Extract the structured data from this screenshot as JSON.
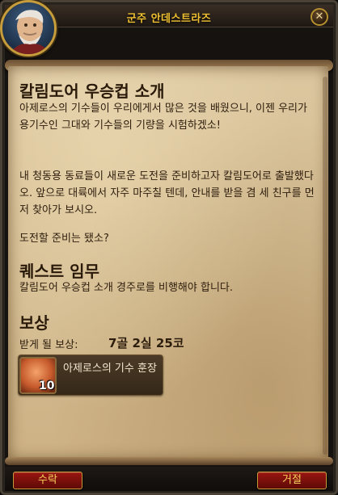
{
  "window": {
    "title": "군주 안데스트라즈",
    "close_icon": "close-icon",
    "portrait_icon": "npc-portrait-icon"
  },
  "quest": {
    "title": "칼림도어 우승컵 소개",
    "description_1": "아제로스의 기수들이 우리에게서 많은 것을 배웠으니, 이젠 우리가 용기수인 그대와 기수들의 기량을 시험하겠소!",
    "description_2": "내 청동용 동료들이 새로운 도전을 준비하고자 칼림도어로 출발했다오. 앞으로 대륙에서 자주 마주칠 텐데, 안내를 받을 겸 세 친구를 먼저 찾아가 보시오.",
    "description_3": "도전할 준비는 됐소?",
    "objectives_header": "퀘스트 임무",
    "objectives_text": "칼림도어 우승컵 소개 경주로를 비행해야 합니다."
  },
  "rewards": {
    "header": "보상",
    "receive_label": "받게 될 보상:",
    "money": "7골 2실 25코",
    "item": {
      "name": "아제로스의 기수 훈장",
      "count": "10",
      "icon": "medal-icon"
    }
  },
  "buttons": {
    "accept": "수락",
    "decline": "거절"
  },
  "colors": {
    "title": "#f1c232",
    "parchment": "#d6bf93",
    "button": "#8a130d",
    "button_text": "#f5d25c"
  }
}
